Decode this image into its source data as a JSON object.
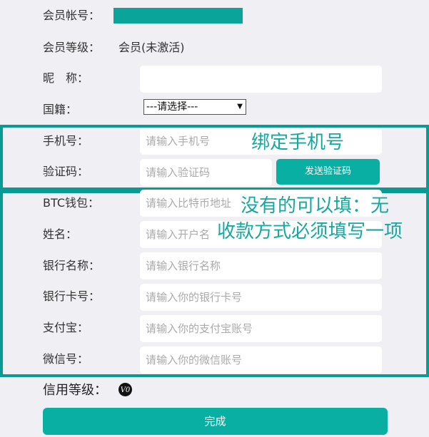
{
  "account": {
    "label": "会员帐号："
  },
  "level": {
    "label": "会员等级：",
    "value": "会员(未激活)"
  },
  "nickname": {
    "label": "昵　称：",
    "value": ""
  },
  "nationality": {
    "label": "国籍：",
    "selected": "---请选择---"
  },
  "phone": {
    "label": "手机号：",
    "placeholder": "请输入手机号"
  },
  "code": {
    "label": "验证码：",
    "placeholder": "请输入验证码",
    "send_label": "发送验证码"
  },
  "annotation_phone": "绑定手机号",
  "annotation_payment": {
    "line1": "没有的可以填：无",
    "line2": "收款方式必须填写一项"
  },
  "btc": {
    "label": "BTC钱包：",
    "placeholder": "请输入比特币地址"
  },
  "name": {
    "label": "姓名：",
    "placeholder": "请输入开户名"
  },
  "bank_name": {
    "label": "银行名称：",
    "placeholder": "请输入银行名称"
  },
  "bank_card": {
    "label": "银行卡号：",
    "placeholder": "请输入你的银行卡号"
  },
  "alipay": {
    "label": "支付宝：",
    "placeholder": "请输入你的支付宝账号"
  },
  "wechat": {
    "label": "微信号：",
    "placeholder": "请输入你的微信账号"
  },
  "credit": {
    "label": "信用等级：",
    "badge": "V0",
    "badge_icon": "v0-badge-icon"
  },
  "submit_label": "完成",
  "colors": {
    "accent": "#0aafa3",
    "frame": "#0a9a94",
    "background": "#f0eff4"
  }
}
